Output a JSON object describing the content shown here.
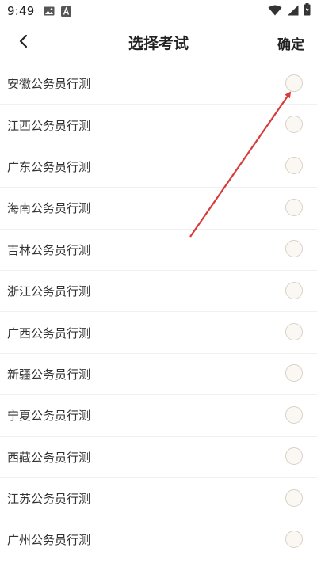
{
  "status_bar": {
    "time": "9:49",
    "icons_left": [
      "image-icon",
      "a-badge-icon"
    ],
    "icons_right": [
      "wifi-icon",
      "signal-icon",
      "battery-charging-icon"
    ]
  },
  "header": {
    "back_icon": "chevron-left-icon",
    "title": "选择考试",
    "confirm_label": "确定"
  },
  "exams": [
    {
      "label": "安徽公务员行测",
      "selected": false
    },
    {
      "label": "江西公务员行测",
      "selected": false
    },
    {
      "label": "广东公务员行测",
      "selected": false
    },
    {
      "label": "海南公务员行测",
      "selected": false
    },
    {
      "label": "吉林公务员行测",
      "selected": false
    },
    {
      "label": "浙江公务员行测",
      "selected": false
    },
    {
      "label": "广西公务员行测",
      "selected": false
    },
    {
      "label": "新疆公务员行测",
      "selected": false
    },
    {
      "label": "宁夏公务员行测",
      "selected": false
    },
    {
      "label": "西藏公务员行测",
      "selected": false
    },
    {
      "label": "江苏公务员行测",
      "selected": false
    },
    {
      "label": "广州公务员行测",
      "selected": false
    }
  ],
  "colors": {
    "radio_border": "#d9d0c8",
    "radio_fill": "#fbf8f3",
    "annotation_arrow": "#d93a3a",
    "divider": "#f0f0f0"
  }
}
